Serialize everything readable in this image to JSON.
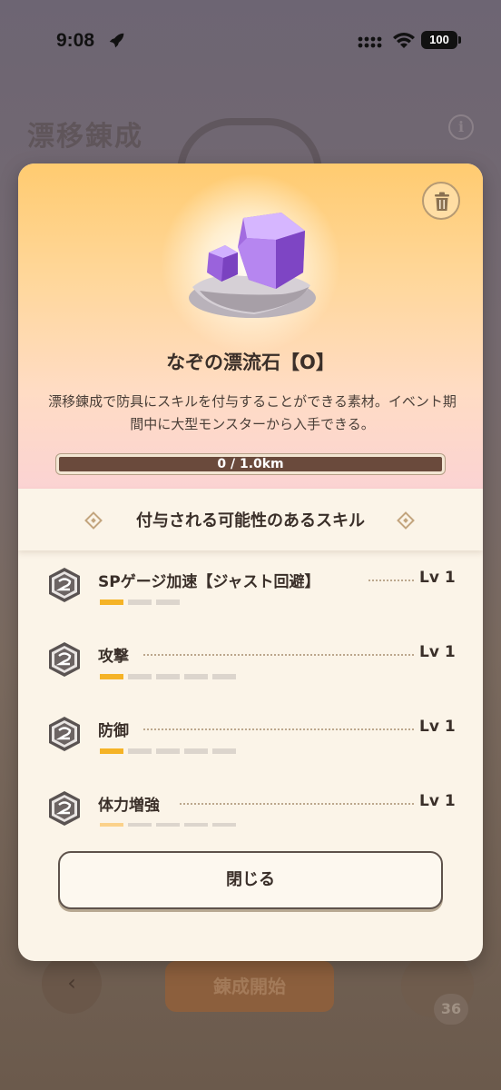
{
  "status_bar": {
    "time": "9:08",
    "battery": "100"
  },
  "background_page": {
    "title": "漂移錬成",
    "start_button": "錬成開始",
    "item_count": "36"
  },
  "modal": {
    "item_name": "なぞの漂流石【O】",
    "description": "漂移錬成で防具にスキルを付与することができる素材。イベント期間中に大型モンスターから入手できる。",
    "progress": {
      "label": "0 / 1.0km",
      "fraction": 0
    },
    "section_title": "付与される可能性のあるスキル",
    "skills": [
      {
        "name": "SPゲージ加速【ジャスト回避】",
        "level": "Lv 1",
        "max_level": 3,
        "filled": 1
      },
      {
        "name": "攻撃",
        "level": "Lv 1",
        "max_level": 5,
        "filled": 1
      },
      {
        "name": "防御",
        "level": "Lv 1",
        "max_level": 5,
        "filled": 1
      },
      {
        "name": "体力増強",
        "level": "Lv 1",
        "max_level": 5,
        "filled": 1
      }
    ],
    "close_label": "閉じる"
  },
  "icons": {
    "trash": "trash-icon",
    "skill": "skill-badge-icon",
    "back": "chevron-left-icon",
    "info": "info-icon"
  },
  "colors": {
    "accent_bar": "#f5b326",
    "progress_track": "#6a4a3c",
    "modal_bg": "#fbf4e8"
  }
}
